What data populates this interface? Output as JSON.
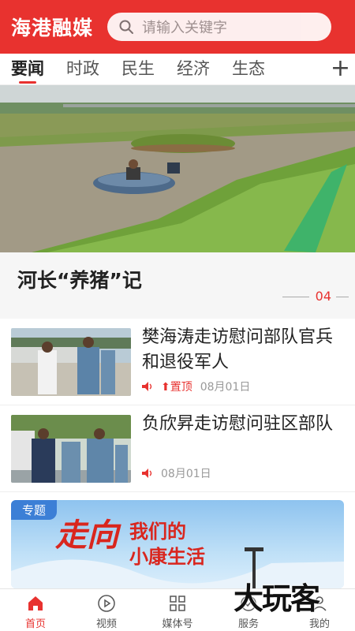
{
  "header": {
    "app_title": "海港融媒",
    "search_placeholder": "请输入关键字",
    "icon": "search-icon",
    "color": "#e8322f"
  },
  "tabs": {
    "items": [
      {
        "label": "要闻",
        "active": true
      },
      {
        "label": "时政",
        "active": false
      },
      {
        "label": "民生",
        "active": false
      },
      {
        "label": "经济",
        "active": false
      },
      {
        "label": "生态",
        "active": false
      }
    ],
    "add_label": "+"
  },
  "featured": {
    "title": "河长“养猪”记",
    "index": "04"
  },
  "news": [
    {
      "title": "樊海涛走访慰问部队官兵和退役军人",
      "pin": "置顶",
      "date": "08月01日"
    },
    {
      "title": "负欣昇走访慰问驻区部队",
      "date": "08月01日"
    }
  ],
  "banner": {
    "tag": "专题",
    "title_part1": "走向",
    "title_part2": "我们的",
    "title_part3": "小康生活"
  },
  "bottom_nav": [
    {
      "label": "首页",
      "icon": "home-icon",
      "active": true
    },
    {
      "label": "视频",
      "icon": "play-icon",
      "active": false
    },
    {
      "label": "媒体号",
      "icon": "grid-icon",
      "active": false
    },
    {
      "label": "服务",
      "icon": "service-icon",
      "active": false
    },
    {
      "label": "我的",
      "icon": "user-icon",
      "active": false
    }
  ],
  "watermark": "大玩客"
}
